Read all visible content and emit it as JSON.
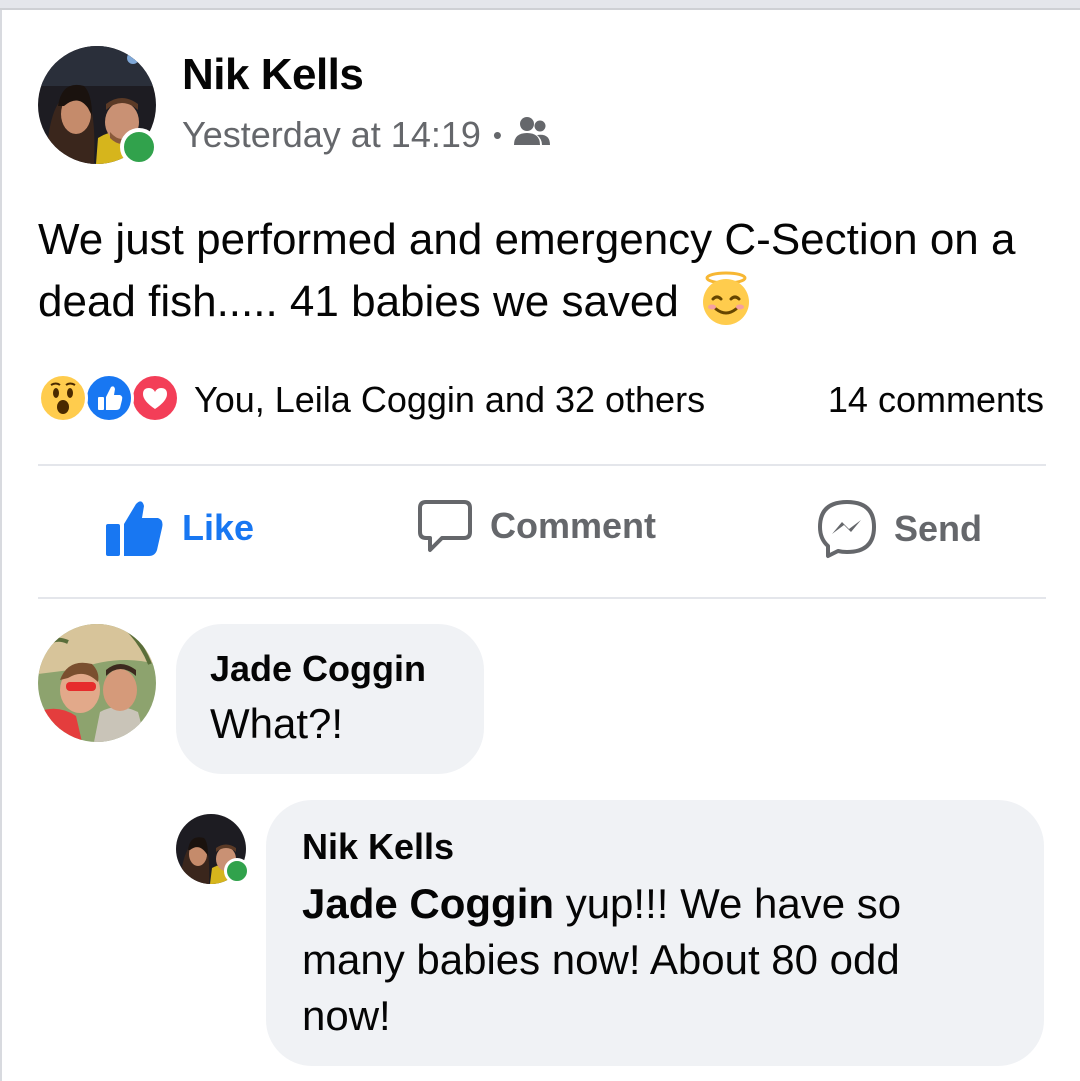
{
  "post": {
    "author": "Nik Kells",
    "timestamp": "Yesterday at 14:19",
    "separator": "•",
    "audience_icon": "friends-icon",
    "text": "We just performed and emergency C-Section on a dead fish..... 41 babies we saved",
    "emoji": "smiling-face-with-halo-emoji",
    "reactions": {
      "icons": [
        "wow-reaction-icon",
        "like-reaction-icon",
        "love-reaction-icon"
      ],
      "summary": "You, Leila Coggin and 32 others",
      "comments": "14 comments"
    },
    "actions": {
      "like": "Like",
      "comment": "Comment",
      "send": "Send"
    }
  },
  "comments": [
    {
      "author": "Jade Coggin",
      "text": "What?!"
    },
    {
      "author": "Nik Kells",
      "mention": "Jade Coggin",
      "text": " yup!!! We have so many babies now! About 80 odd now!",
      "online": true
    }
  ],
  "colors": {
    "brand_blue": "#1877f2",
    "online_green": "#31a24c",
    "secondary_text": "#65676b",
    "bubble_bg": "#f0f2f5"
  }
}
